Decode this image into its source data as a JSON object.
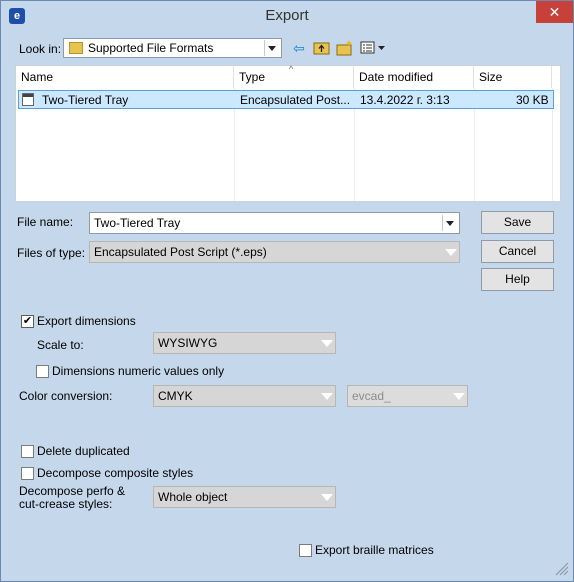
{
  "window": {
    "title": "Export",
    "close_glyph": "✕",
    "app_icon": "logo-icon"
  },
  "lookin": {
    "label": "Look in:",
    "value": "Supported File Formats"
  },
  "toolbar_icons": [
    "back-arrow-icon",
    "up-folder-icon",
    "new-folder-icon",
    "view-menu-icon"
  ],
  "file_list": {
    "columns": [
      "Name",
      "Type",
      "Date modified",
      "Size"
    ],
    "rows": [
      {
        "name": "Two-Tiered Tray",
        "type": "Encapsulated Post...",
        "date": "13.4.2022 г. 3:13",
        "size": "30 KB"
      }
    ]
  },
  "file_name": {
    "label": "File name:",
    "value": "Two-Tiered Tray"
  },
  "file_type": {
    "label": "Files of type:",
    "value": "Encapsulated Post Script (*.eps)"
  },
  "buttons": {
    "save": "Save",
    "cancel": "Cancel",
    "help": "Help"
  },
  "options": {
    "export_dimensions": {
      "label": "Export dimensions",
      "checked": true
    },
    "scale_to": {
      "label": "Scale to:",
      "value": "WYSIWYG"
    },
    "numeric_only": {
      "label": "Dimensions numeric values only",
      "checked": false
    },
    "color_conversion": {
      "label": "Color conversion:",
      "value": "CMYK",
      "secondary": "evcad_"
    },
    "delete_duplicated": {
      "label": "Delete duplicated",
      "checked": false
    },
    "decompose_composite": {
      "label": "Decompose composite styles",
      "checked": false
    },
    "decompose_perfo": {
      "label_line1": "Decompose perfo &",
      "label_line2": "cut-crease styles:",
      "value": "Whole object"
    },
    "export_braille": {
      "label": "Export braille matrices",
      "checked": false
    }
  },
  "colors": {
    "dialog_bg": "#c5d7ea",
    "close_red": "#c7403a",
    "selection": "#cce8ff"
  }
}
